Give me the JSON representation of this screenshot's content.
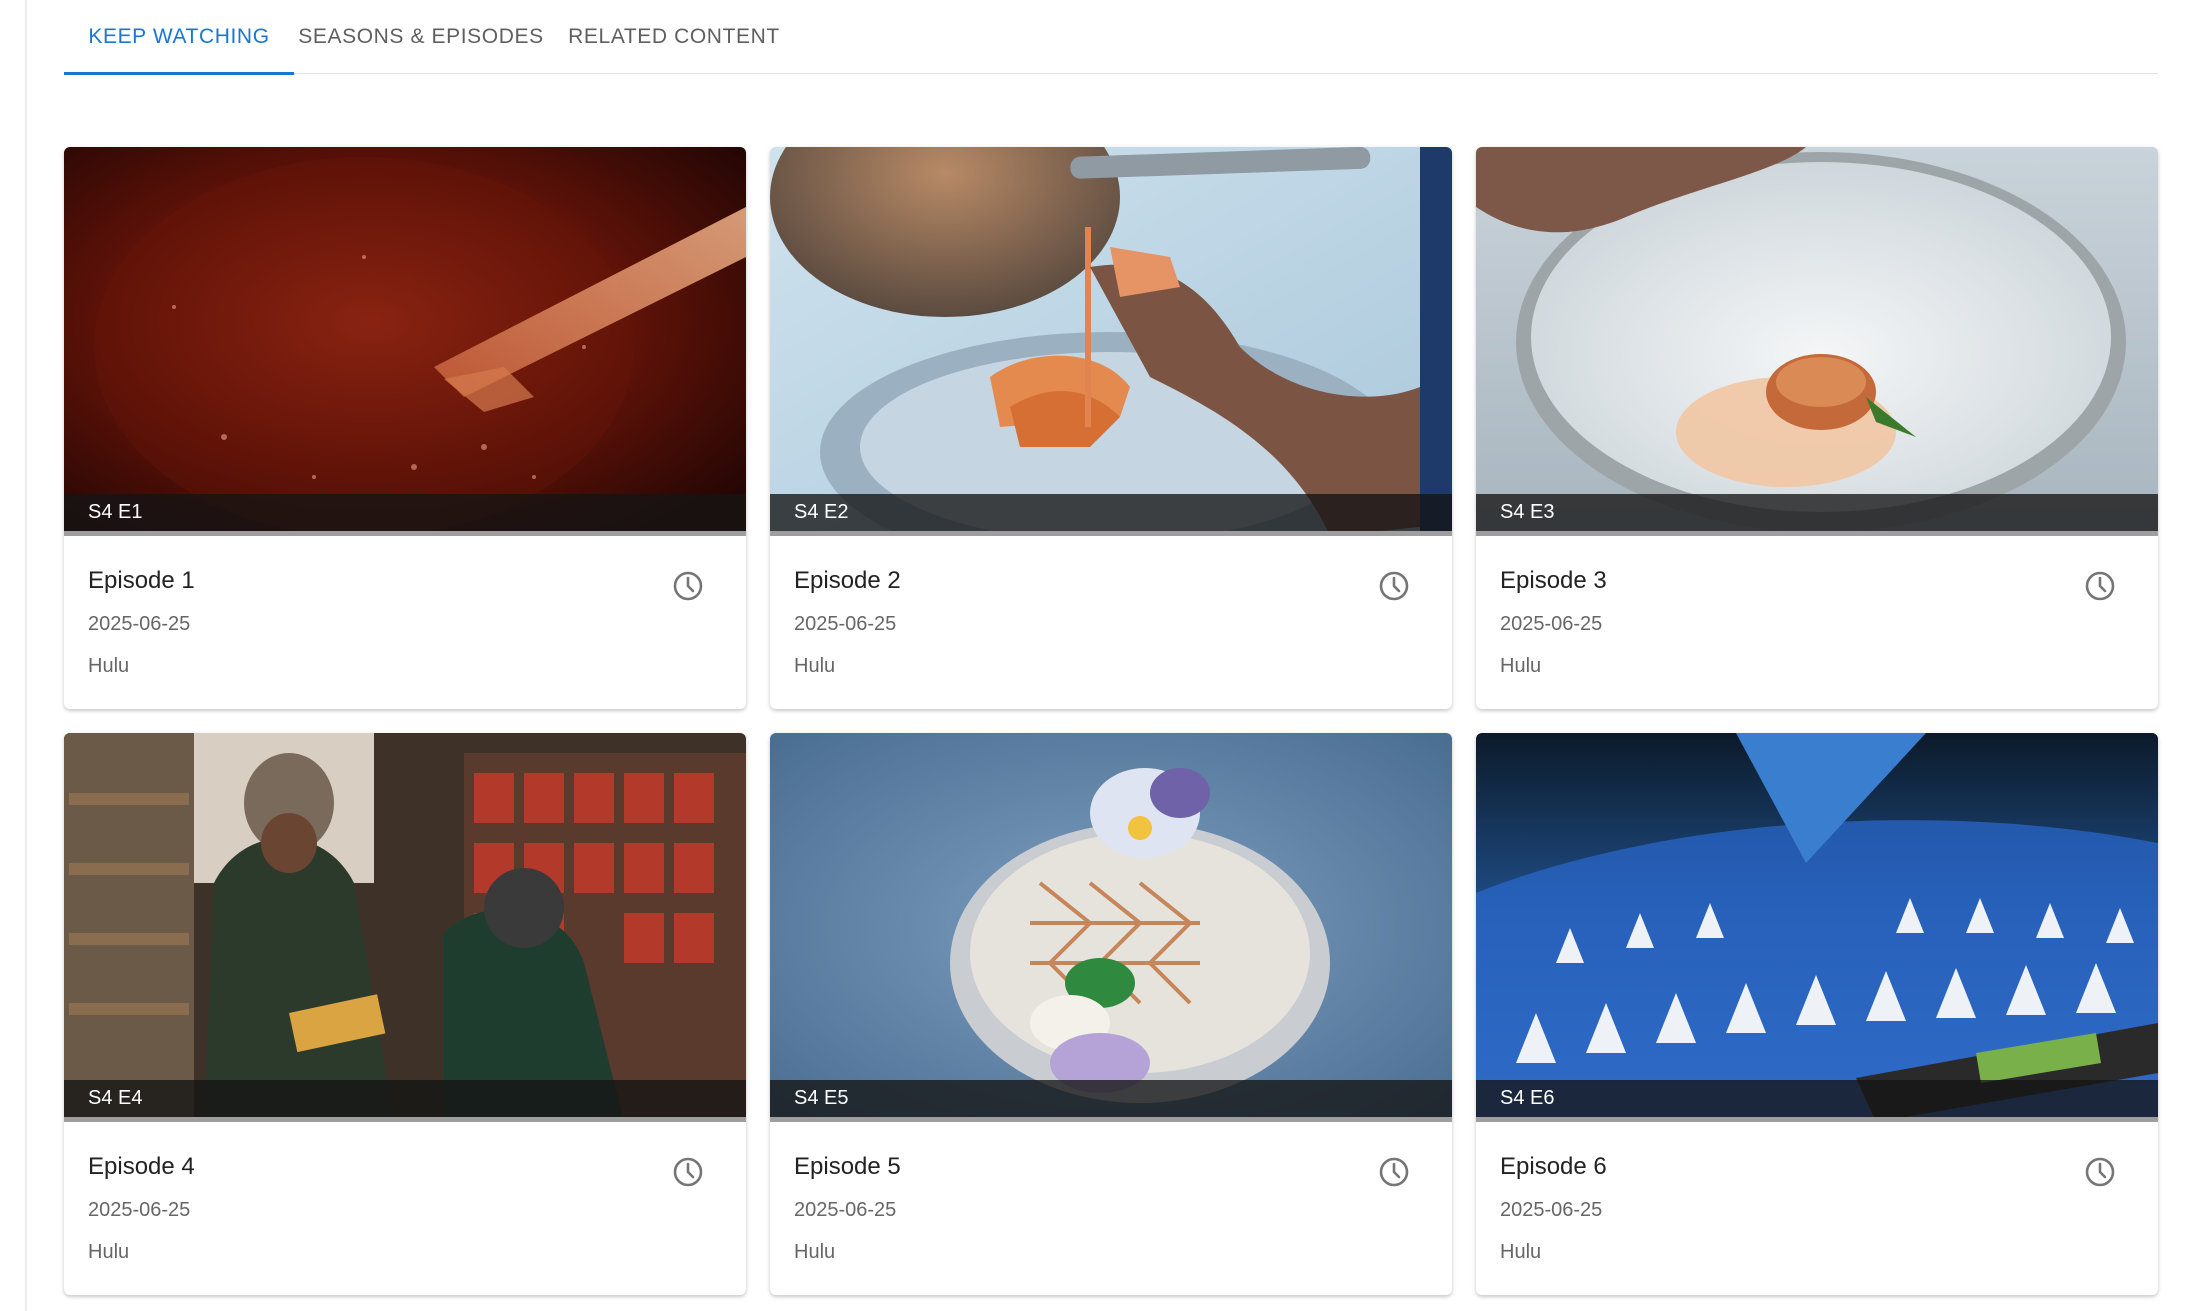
{
  "tabs": [
    {
      "label": "KEEP WATCHING",
      "active": true
    },
    {
      "label": "SEASONS & EPISODES",
      "active": false
    },
    {
      "label": "RELATED CONTENT",
      "active": false
    }
  ],
  "colors": {
    "accent": "#1976d2",
    "text": "#222222",
    "muted": "#666666"
  },
  "episodes": [
    {
      "badge": "S4 E1",
      "title": "Episode 1",
      "date": "2025-06-25",
      "source": "Hulu",
      "icon": "clock-icon",
      "progress": 1.0
    },
    {
      "badge": "S4 E2",
      "title": "Episode 2",
      "date": "2025-06-25",
      "source": "Hulu",
      "icon": "clock-icon",
      "progress": 1.0
    },
    {
      "badge": "S4 E3",
      "title": "Episode 3",
      "date": "2025-06-25",
      "source": "Hulu",
      "icon": "clock-icon",
      "progress": 1.0
    },
    {
      "badge": "S4 E4",
      "title": "Episode 4",
      "date": "2025-06-25",
      "source": "Hulu",
      "icon": "clock-icon",
      "progress": 1.0
    },
    {
      "badge": "S4 E5",
      "title": "Episode 5",
      "date": "2025-06-25",
      "source": "Hulu",
      "icon": "clock-icon",
      "progress": 1.0
    },
    {
      "badge": "S4 E6",
      "title": "Episode 6",
      "date": "2025-06-25",
      "source": "Hulu",
      "icon": "clock-icon",
      "progress": 1.0
    }
  ]
}
